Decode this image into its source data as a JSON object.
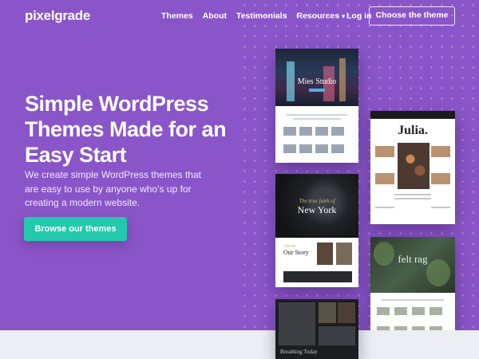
{
  "header": {
    "logo": "pixelgrade",
    "nav": [
      {
        "label": "Themes"
      },
      {
        "label": "About"
      },
      {
        "label": "Testimonials"
      },
      {
        "label": "Resources",
        "has_dropdown": true
      }
    ],
    "login": "Log in",
    "cta": "Choose the theme"
  },
  "hero": {
    "headline": "Simple WordPress Themes Made for an Easy Start",
    "subtitle": "We create simple WordPress themes that are easy to use by anyone who’s up for creating a modern website.",
    "button": "Browse our themes"
  },
  "showcase": {
    "cards": [
      {
        "title": "Mies Studio"
      },
      {
        "title": "Julia."
      },
      {
        "script": "The true faith of",
        "title": "New York",
        "story_kicker": "About",
        "story_title": "Our Story"
      },
      {
        "title": "felt rag"
      },
      {
        "caption": "Breathing Today"
      }
    ]
  },
  "colors": {
    "hero_bg": "#8a55c8",
    "accent": "#22c9ad"
  }
}
